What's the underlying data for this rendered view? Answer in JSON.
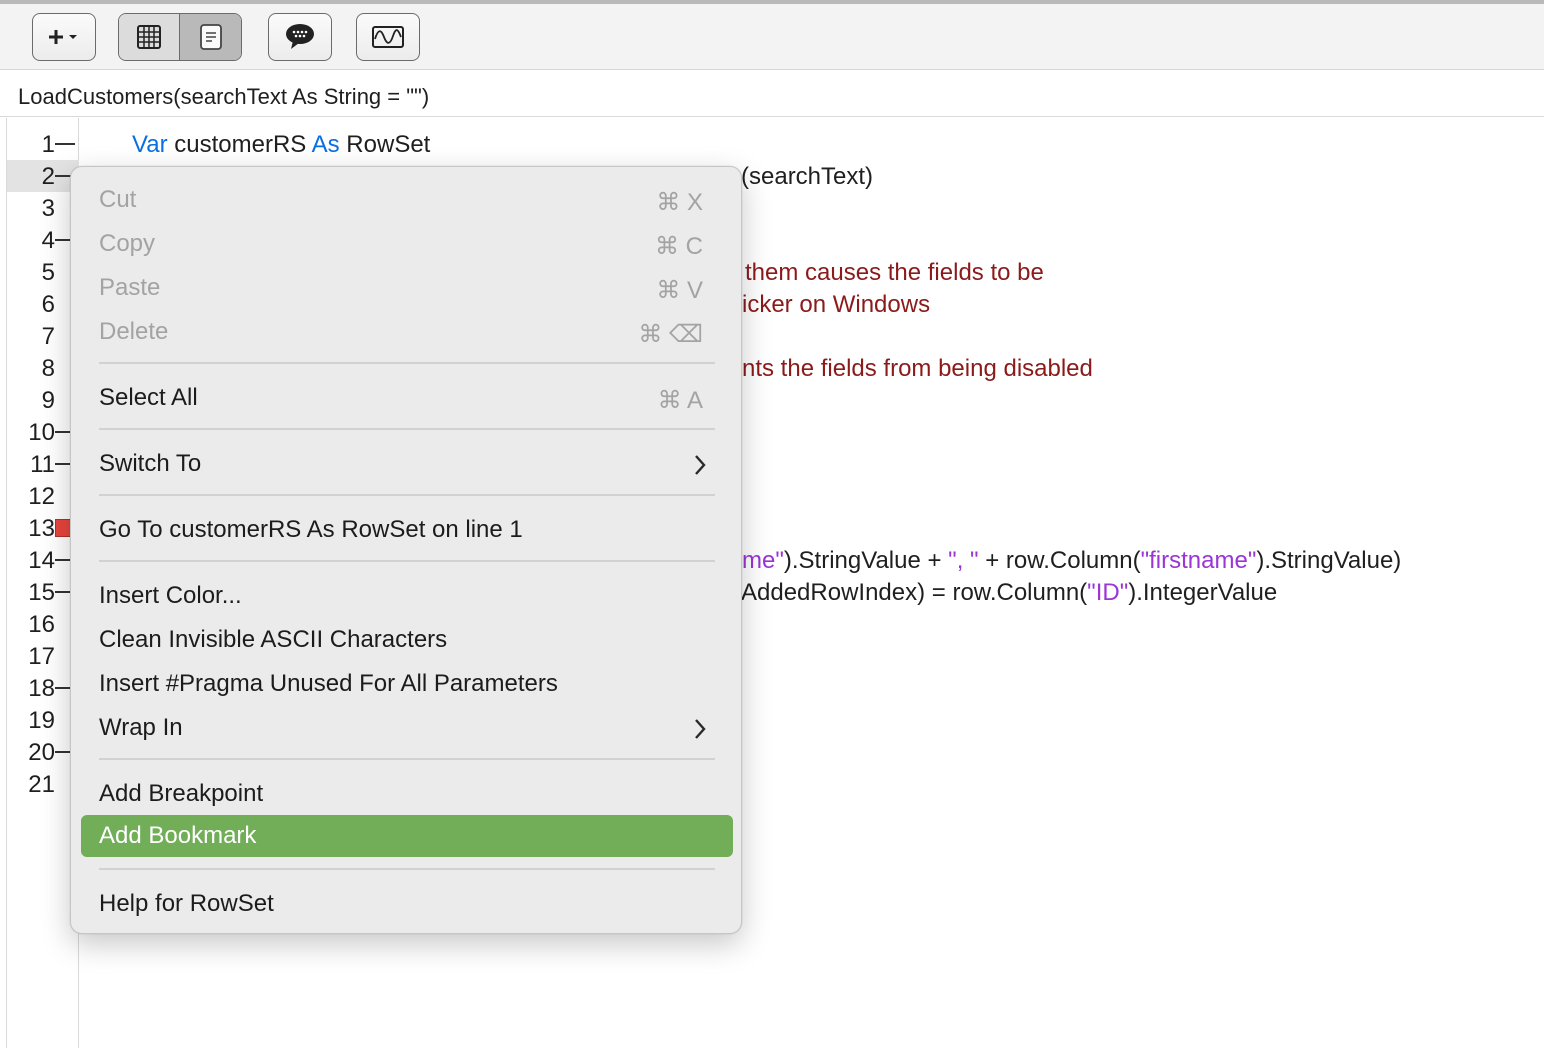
{
  "signature": "LoadCustomers(searchText As String = \"\")",
  "toolbar": {
    "add_icon": "plus-dropdown-icon",
    "view_toggle": [
      "table-grid-icon",
      "document-text-icon"
    ],
    "comment_icon": "speech-bubble-icon",
    "wave_icon": "waveform-icon"
  },
  "gutter": {
    "lines": [
      "1",
      "2",
      "3",
      "4",
      "5",
      "6",
      "7",
      "8",
      "9",
      "10",
      "11",
      "12",
      "13",
      "14",
      "15",
      "16",
      "17",
      "18",
      "19",
      "20",
      "21"
    ],
    "highlighted_line": "2",
    "breakpoint_line": "13"
  },
  "code": {
    "line1": {
      "kw1": "Var",
      "t1": " customerRS ",
      "kw2": "As",
      "t2": " RowSet"
    },
    "line2": "(searchText)",
    "line5": "them causes the fields to be",
    "line6": "icker on Windows",
    "line8": "nts the fields from being disabled",
    "line14": {
      "s1": "me\"",
      "t1": ").StringValue + ",
      "s2": "\", \"",
      "t2": " + row.Column(",
      "s3": "\"firstname\"",
      "t3": ").StringValue)"
    },
    "line15": {
      "t1": "AddedRowIndex) = row.Column(",
      "s1": "\"ID\"",
      "t2": ").IntegerValue"
    }
  },
  "menu": {
    "cut": {
      "label": "Cut",
      "shortcut": "⌘ X"
    },
    "copy": {
      "label": "Copy",
      "shortcut": "⌘ C"
    },
    "paste": {
      "label": "Paste",
      "shortcut": "⌘ V"
    },
    "delete": {
      "label": "Delete",
      "shortcut": "⌘ ⌫"
    },
    "select_all": {
      "label": "Select All",
      "shortcut": "⌘ A"
    },
    "switch_to": "Switch To",
    "go_to": "Go To customerRS As RowSet on line 1",
    "insert_color": "Insert Color...",
    "clean_ascii": "Clean Invisible ASCII Characters",
    "insert_pragma": "Insert #Pragma Unused For All Parameters",
    "wrap_in": "Wrap In",
    "add_breakpoint": "Add Breakpoint",
    "add_bookmark": "Add Bookmark",
    "help": "Help for RowSet"
  },
  "colors": {
    "keyword": "#0a6fe0",
    "comment": "#8b1a1a",
    "string": "#9a35d6",
    "menu_highlight": "#72ad58",
    "breakpoint": "#e8453c"
  }
}
